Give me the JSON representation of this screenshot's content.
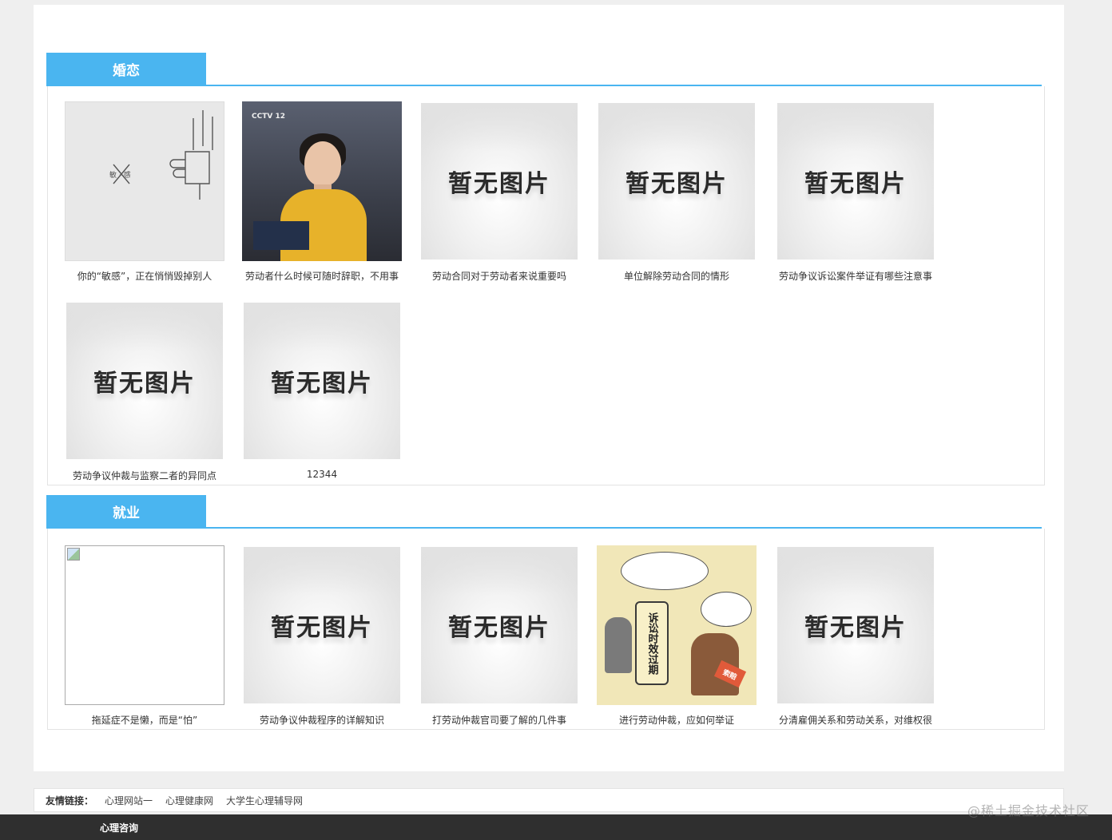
{
  "sections": [
    {
      "title": "婚恋",
      "items": [
        {
          "caption": "你的“敏感”，正在悄悄毁掉别人",
          "image": "sensitive-illustration",
          "image_text": "敏 · 感"
        },
        {
          "caption": "劳动者什么时候可随时辞职，不用事",
          "image": "news-anchor",
          "image_text": "CCTV 12"
        },
        {
          "caption": "劳动合同对于劳动者来说重要吗",
          "image": "placeholder",
          "image_text": "暂无图片"
        },
        {
          "caption": "单位解除劳动合同的情形",
          "image": "placeholder",
          "image_text": "暂无图片"
        },
        {
          "caption": "劳动争议诉讼案件举证有哪些注意事",
          "image": "placeholder",
          "image_text": "暂无图片"
        },
        {
          "caption": "劳动争议仲裁与监察二者的异同点",
          "image": "placeholder",
          "image_text": "暂无图片"
        },
        {
          "caption": "12344",
          "image": "placeholder",
          "image_text": "暂无图片"
        }
      ]
    },
    {
      "title": "就业",
      "items": [
        {
          "caption": "拖延症不是懒，而是“怕”",
          "image": "broken-image"
        },
        {
          "caption": "劳动争议仲裁程序的详解知识",
          "image": "placeholder",
          "image_text": "暂无图片"
        },
        {
          "caption": "打劳动仲裁官司要了解的几件事",
          "image": "placeholder",
          "image_text": "暂无图片"
        },
        {
          "caption": "进行劳动仲裁，应如何举证",
          "image": "comic",
          "image_text": "诉讼时效过期",
          "image_tag": "索赔"
        },
        {
          "caption": "分清雇佣关系和劳动关系，对维权很",
          "image": "placeholder",
          "image_text": "暂无图片"
        }
      ]
    }
  ],
  "footer": {
    "label": "友情链接：",
    "links": [
      "心理网站一",
      "心理健康网",
      "大学生心理辅导网"
    ]
  },
  "bottom_bar": {
    "label": "心理咨询"
  },
  "watermark": "@稀土掘金技术社区",
  "colors": {
    "accent": "#4ab5f0",
    "bottom_bar": "#2f2f2f"
  }
}
